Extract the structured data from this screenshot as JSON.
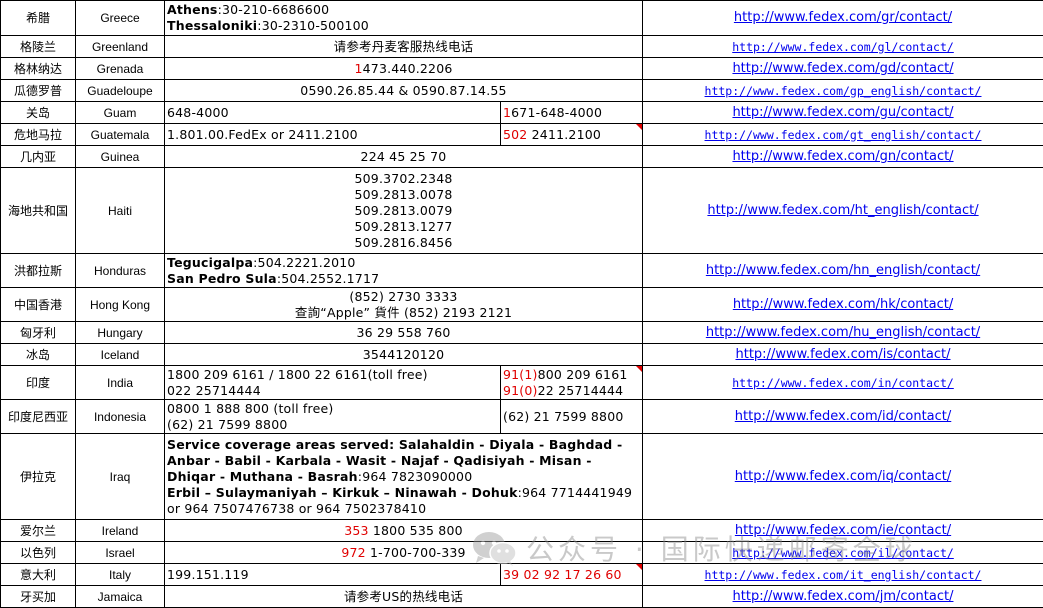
{
  "rows": [
    {
      "cn": "希腊",
      "en": "Greece",
      "url": "http://www.fedex.com/gr/contact/"
    },
    {
      "cn": "格陵兰",
      "en": "Greenland",
      "phone": "请参考丹麦客服热线电话",
      "url": "http://www.fedex.com/gl/contact/"
    },
    {
      "cn": "格林纳达",
      "en": "Grenada",
      "url": "http://www.fedex.com/gd/contact/"
    },
    {
      "cn": "瓜德罗普",
      "en": "Guadeloupe",
      "phone": "0590.26.85.44 & 0590.87.14.55",
      "url": "http://www.fedex.com/gp_english/contact/"
    },
    {
      "cn": "关岛",
      "en": "Guam",
      "phone": "648-4000",
      "url": "http://www.fedex.com/gu/contact/"
    },
    {
      "cn": "危地马拉",
      "en": "Guatemala",
      "phone": "1.801.00.FedEx or 2411.2100",
      "url": "http://www.fedex.com/gt_english/contact/"
    },
    {
      "cn": "几内亚",
      "en": "Guinea",
      "phone": "224 45 25 70",
      "url": "http://www.fedex.com/gn/contact/"
    },
    {
      "cn": "海地共和国",
      "en": "Haiti",
      "phones": [
        "509.3702.2348",
        "509.2813.0078",
        "509.2813.0079",
        "509.2813.1277",
        "509.2816.8456"
      ],
      "url": "http://www.fedex.com/ht_english/contact/"
    },
    {
      "cn": "洪都拉斯",
      "en": "Honduras",
      "url": "http://www.fedex.com/hn_english/contact/"
    },
    {
      "cn": "中国香港",
      "en": "Hong Kong",
      "phones": [
        "(852) 2730 3333",
        "查詢“Apple” 貨件 (852) 2193 2121"
      ],
      "url": "http://www.fedex.com/hk/contact/"
    },
    {
      "cn": "匈牙利",
      "en": "Hungary",
      "phone": "36 29 558 760",
      "url": "http://www.fedex.com/hu_english/contact/"
    },
    {
      "cn": "冰岛",
      "en": "Iceland",
      "phone": "3544120120",
      "url": "http://www.fedex.com/is/contact/"
    },
    {
      "cn": "印度",
      "en": "India",
      "phones": [
        "1800 209 6161 / 1800 22 6161(toll free)",
        "022 25714444"
      ],
      "url": "http://www.fedex.com/in/contact/"
    },
    {
      "cn": "印度尼西亚",
      "en": "Indonesia",
      "phones": [
        "0800 1 888 800 (toll free)",
        "(62) 21 7599 8800"
      ],
      "phone2": "(62) 21 7599 8800",
      "url": "http://www.fedex.com/id/contact/"
    },
    {
      "cn": "伊拉克",
      "en": "Iraq",
      "url": "http://www.fedex.com/iq/contact/"
    },
    {
      "cn": "爱尔兰",
      "en": "Ireland",
      "url": "http://www.fedex.com/ie/contact/"
    },
    {
      "cn": "以色列",
      "en": "Israel",
      "url": "http://www.fedex.com/il/contact/"
    },
    {
      "cn": "意大利",
      "en": "Italy",
      "phone": "199.151.119",
      "url": "http://www.fedex.com/it_english/contact/"
    },
    {
      "cn": "牙买加",
      "en": "Jamaica",
      "phone": "请参考US的热线电话",
      "url": "http://www.fedex.com/jm/contact/"
    }
  ],
  "greece": {
    "city1": "Athens",
    "num1": ":30-210-6686600",
    "city2": "Thessaloniki",
    "num2": ":30-2310-500100"
  },
  "grenada": {
    "prefix": "1",
    "number": "473.440.2206"
  },
  "guam": {
    "prefix": "1",
    "number": "671-648-4000"
  },
  "guatemala": {
    "prefix": "502",
    "number": " 2411.2100"
  },
  "honduras": {
    "city1": "Tegucigalpa",
    "num1": ":504.2221.2010",
    "city2": "San Pedro Sula",
    "num2": ":504.2552.1717"
  },
  "india_intl": {
    "p1": "91(1)",
    "n1": "800 209 6161",
    "p2": "91(0)",
    "n2": "22 25714444"
  },
  "iraq": {
    "line1_bold": "Service coverage areas served: Salahaldin - Diyala - Baghdad -",
    "line2_bold": "Anbar - Babil - Karbala - Wasit - Najaf - Qadisiyah - Misan -",
    "line3_bold": "Dhiqar - Muthana - Basrah",
    "line3_num": ":964 7823090000",
    "line4_bold": "Erbil – Sulaymaniyah – Kirkuk – Ninawah - Dohuk",
    "line4_num": ":964 7714441949",
    "line5": "or 964 7507476738 or 964 7502378410"
  },
  "ireland": {
    "prefix": "353",
    "number": " 1800 535 800"
  },
  "israel": {
    "prefix": "972",
    "number": " 1-700-700-339"
  },
  "italy_intl": {
    "number": "39 02 92 17 26 60"
  },
  "watermark": {
    "text": "公众号 · 国际快递邮寄全球",
    "icon": "wechat-icon"
  }
}
